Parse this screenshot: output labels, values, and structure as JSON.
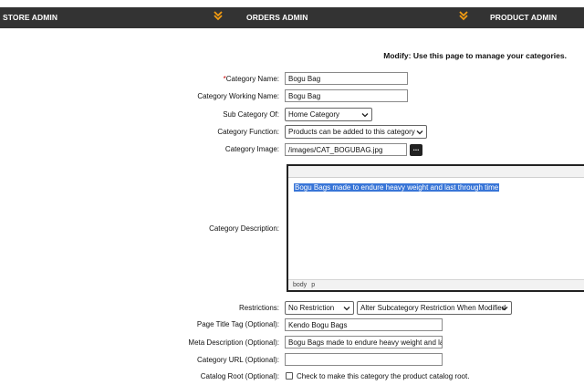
{
  "nav": {
    "store_admin": "STORE ADMIN",
    "orders_admin": "ORDERS ADMIN",
    "product_admin": "PRODUCT ADMIN",
    "chevron_color": "#f39c12",
    "bar_color": "#333333"
  },
  "headline": "Modify: Use this page to manage your categories.",
  "form": {
    "category_name": {
      "required_mark": "*",
      "label": "Category Name:",
      "value": "Bogu Bag"
    },
    "category_working_name": {
      "label": "Category Working Name:",
      "value": "Bogu Bag"
    },
    "sub_category_of": {
      "label": "Sub Category Of:",
      "selected": "Home Category"
    },
    "category_function": {
      "label": "Category Function:",
      "selected": "Products can be added to this category"
    },
    "category_image": {
      "label": "Category Image:",
      "value": "/images/CAT_BOGUBAG.jpg",
      "browse_label": "..."
    },
    "category_description": {
      "label": "Category Description:",
      "content": "Bogu Bags made to endure heavy weight and last through time",
      "status_path": [
        "body",
        "p"
      ],
      "highlight_color": "#3875d7"
    },
    "restrictions": {
      "label": "Restrictions:",
      "selected": "No Restriction",
      "subcategory_selected": "Alter Subcategory Restriction When Modified"
    },
    "page_title_tag": {
      "label": "Page Title Tag (Optional):",
      "value": "Kendo Bogu Bags"
    },
    "meta_description": {
      "label": "Meta Description (Optional):",
      "value": "Bogu Bags made to endure heavy weight and last"
    },
    "category_url": {
      "label": "Category URL (Optional):",
      "value": ""
    },
    "catalog_root": {
      "label": "Catalog Root (Optional):",
      "checkbox_label": "Check to make this category the product catalog root.",
      "checked": false
    }
  }
}
